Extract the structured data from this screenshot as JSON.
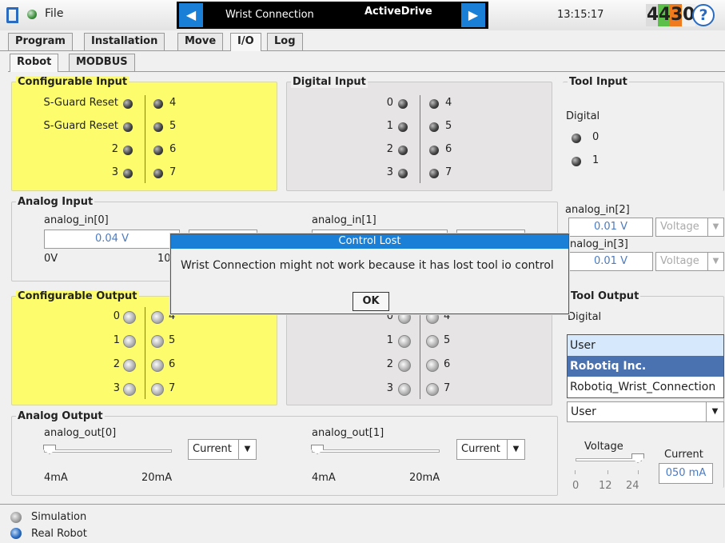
{
  "header": {
    "file_label": "File",
    "prev": "◀",
    "next": "▶",
    "program_name": "Wrist Connection",
    "program_title": "ActiveDrive",
    "clock": "13:15:17",
    "serial": [
      "4",
      "4",
      "3",
      "0"
    ],
    "help": "?"
  },
  "tabs": [
    "Program",
    "Installation",
    "Move",
    "I/O",
    "Log"
  ],
  "subtabs": [
    "Robot",
    "MODBUS"
  ],
  "config_input": {
    "title": "Configurable Input",
    "left": [
      "S-Guard Reset",
      "S-Guard Reset",
      "2",
      "3"
    ],
    "right": [
      "4",
      "5",
      "6",
      "7"
    ]
  },
  "digital_input": {
    "title": "Digital Input",
    "left": [
      "0",
      "1",
      "2",
      "3"
    ],
    "right": [
      "4",
      "5",
      "6",
      "7"
    ]
  },
  "tool_input": {
    "title": "Tool Input",
    "digital_label": "Digital",
    "pins": [
      "0",
      "1"
    ],
    "analog2_label": "analog_in[2]",
    "analog2_value": "0.01 V",
    "analog2_mode": "Voltage",
    "analog3_label": "nalog_in[3]",
    "analog3_value": "0.01 V",
    "analog3_mode": "Voltage"
  },
  "analog_input": {
    "title": "Analog Input",
    "in0_label": "analog_in[0]",
    "in0_value": "0.04 V",
    "in0_min": "0V",
    "in0_max": "10",
    "in1_label": "analog_in[1]"
  },
  "config_output": {
    "title": "Configurable Output",
    "left": [
      "0",
      "1",
      "2",
      "3"
    ],
    "right": [
      "4",
      "5",
      "6",
      "7"
    ]
  },
  "digital_output": {
    "left": [
      "0",
      "1",
      "2",
      "3"
    ],
    "right": [
      "4",
      "5",
      "6",
      "7"
    ]
  },
  "tool_output": {
    "title": "Tool Output",
    "digital_label": "Digital",
    "options": [
      "User",
      "Robotiq Inc.",
      "Robotiq_Wrist_Connection"
    ],
    "selected": "User",
    "voltage_label": "Voltage",
    "voltage_ticks": [
      "0",
      "12",
      "24"
    ],
    "voltage_level": 24,
    "current_label": "Current",
    "current_value": "050 mA"
  },
  "analog_output": {
    "title": "Analog Output",
    "out0_label": "analog_out[0]",
    "out0_mode": "Current",
    "out0_min": "4mA",
    "out0_max": "20mA",
    "out1_label": "analog_out[1]",
    "out1_mode": "Current",
    "out1_min": "4mA",
    "out1_max": "20mA"
  },
  "dialog": {
    "title": "Control Lost",
    "message": "Wrist Connection might not work because it has lost tool io control",
    "ok": "OK"
  },
  "footer": {
    "simulation": "Simulation",
    "real_robot": "Real Robot"
  },
  "colors": {
    "accent": "#1a7fd6",
    "config_bg": "#fcfc6c",
    "serial": [
      "#a0a0a0",
      "#5cbf4a",
      "#f07a1e",
      "#f0f0f0"
    ]
  }
}
